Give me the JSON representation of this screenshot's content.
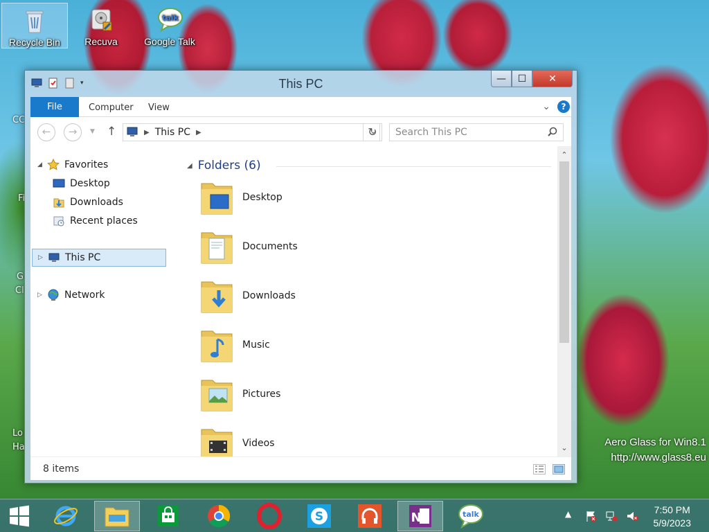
{
  "desktop": {
    "icons": [
      {
        "label": "Recycle Bin"
      },
      {
        "label": "Recuva"
      },
      {
        "label": "Google Talk"
      }
    ],
    "side_labels": [
      "CC",
      "Fi",
      "G",
      "Cl",
      "Lo",
      "Ha"
    ],
    "watermark": {
      "line1": "Aero Glass for Win8.1",
      "line2": "http://www.glass8.eu"
    }
  },
  "window": {
    "title": "This PC",
    "controls": {
      "minimize": "—",
      "maximize": "☐",
      "close": "✕"
    },
    "ribbon": {
      "tabs": [
        "File",
        "Computer",
        "View"
      ],
      "help": "?"
    },
    "address": {
      "crumbs": [
        "This PC"
      ]
    },
    "search": {
      "placeholder": "Search This PC"
    },
    "navpane": {
      "favorites": "Favorites",
      "favorites_items": [
        "Desktop",
        "Downloads",
        "Recent places"
      ],
      "this_pc": "This PC",
      "network": "Network"
    },
    "group": {
      "title": "Folders (6)"
    },
    "folders": [
      {
        "label": "Desktop",
        "overlay": "desktop"
      },
      {
        "label": "Documents",
        "overlay": "documents"
      },
      {
        "label": "Downloads",
        "overlay": "downloads"
      },
      {
        "label": "Music",
        "overlay": "music"
      },
      {
        "label": "Pictures",
        "overlay": "pictures"
      },
      {
        "label": "Videos",
        "overlay": "videos"
      }
    ],
    "status": {
      "count": "8 items"
    }
  },
  "taskbar": {
    "clock": {
      "time": "7:50 PM",
      "date": "5/9/2023"
    }
  },
  "colors": {
    "ribbon_file_tab": "#1979ca",
    "group_heading": "#1e3f87",
    "selected_item_bg": "#d9ebf9"
  }
}
